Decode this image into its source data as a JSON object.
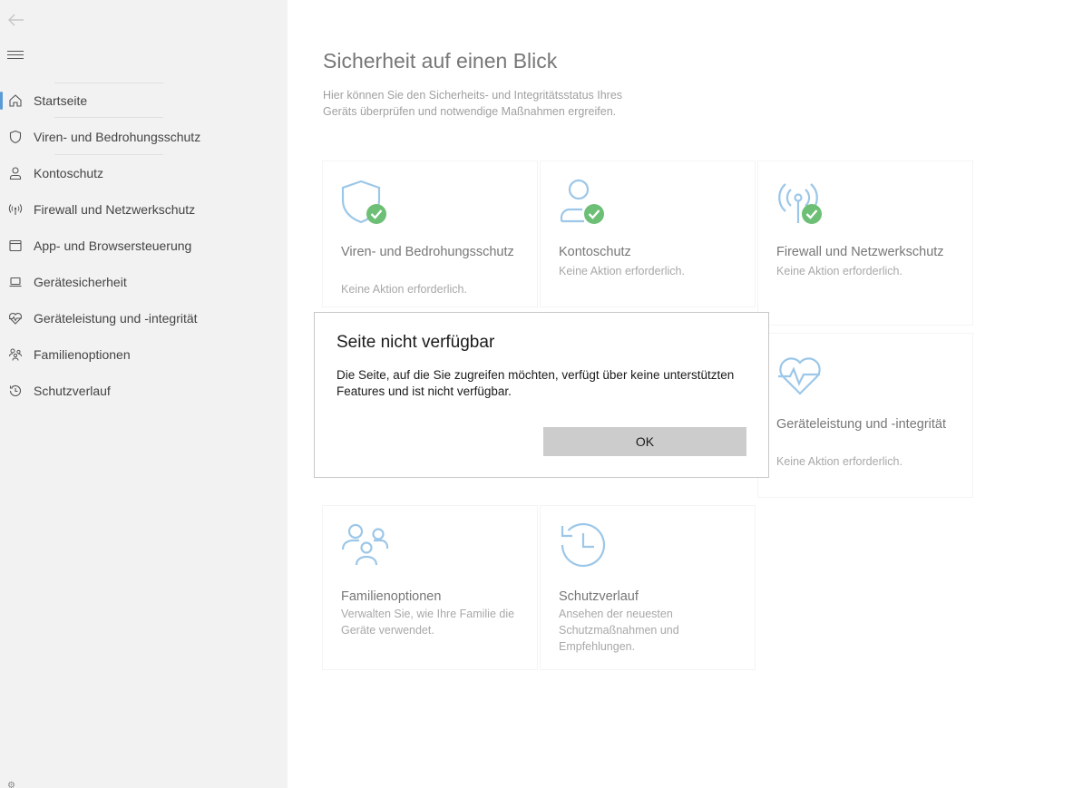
{
  "sidebar": {
    "items": [
      {
        "label": "Startseite",
        "icon": "home-icon"
      },
      {
        "label": "Viren- und Bedrohungsschutz",
        "icon": "shield-icon"
      },
      {
        "label": "Kontoschutz",
        "icon": "person-icon"
      },
      {
        "label": "Firewall und Netzwerkschutz",
        "icon": "antenna-icon"
      },
      {
        "label": "App- und Browsersteuerung",
        "icon": "browser-window-icon"
      },
      {
        "label": "Gerätesicherheit",
        "icon": "laptop-icon"
      },
      {
        "label": "Geräteleistung und -integrität",
        "icon": "heart-pulse-icon"
      },
      {
        "label": "Familienoptionen",
        "icon": "family-icon"
      },
      {
        "label": "Schutzverlauf",
        "icon": "history-icon"
      }
    ],
    "active": "Startseite"
  },
  "main": {
    "title": "Sicherheit auf einen Blick",
    "description": "Hier können Sie den Sicherheits- und Integritätsstatus Ihres Geräts überprüfen und notwendige Maßnahmen ergreifen.",
    "tiles": [
      {
        "title": "Viren- und Bedrohungsschutz",
        "status": "Keine Aktion erforderlich.",
        "icon": "shield-check-icon"
      },
      {
        "title": "Kontoschutz",
        "status": "Keine Aktion erforderlich.",
        "icon": "person-check-icon"
      },
      {
        "title": "Firewall und Netzwerkschutz",
        "status": "Keine Aktion erforderlich.",
        "icon": "antenna-check-icon"
      },
      {
        "title": "Geräteleistung und -integrität",
        "status": "Keine Aktion erforderlich.",
        "icon": "heart-pulse-icon"
      },
      {
        "title": "Familienoptionen",
        "status": "Verwalten Sie, wie Ihre Familie die Geräte verwendet.",
        "icon": "family-icon"
      },
      {
        "title": "Schutzverlauf",
        "status": "Ansehen der neuesten Schutzmaßnahmen und Empfehlungen.",
        "icon": "history-icon"
      }
    ]
  },
  "dialog": {
    "title": "Seite nicht verfügbar",
    "message": "Die Seite, auf die Sie zugreifen möchten, verfügt über keine unterstützten Features und ist nicht verfügbar.",
    "ok_label": "OK"
  },
  "colors": {
    "accent": "#5a9bd5",
    "icon_blue": "#9cc7e8",
    "check_green": "#6cbf75",
    "sidebar_bg": "#f2f2f2"
  }
}
